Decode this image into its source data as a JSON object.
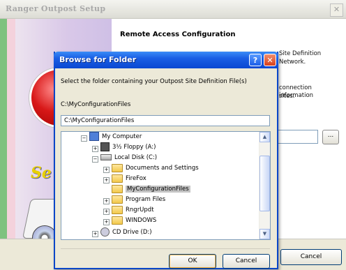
{
  "setup_window": {
    "title": "Ranger Outpost Setup",
    "close_glyph": "✕",
    "heading": "Remote Access Configuration",
    "side_text_1": "Site Definition",
    "side_text_2": "Network.",
    "side_text_3": "connection information",
    "side_text_4": "sites.",
    "banner_script": "Se",
    "browse_label": "...",
    "cancel_label": "Cancel"
  },
  "dialog": {
    "title": "Browse for Folder",
    "help_glyph": "?",
    "close_glyph": "✕",
    "instruction": "Select the folder containing your Outpost Site Definition File(s)",
    "current_path": "C:\\MyConfigurationFiles",
    "path_value": "C:\\MyConfigurationFiles",
    "ok_label": "OK",
    "cancel_label": "Cancel"
  },
  "tree": {
    "items": [
      {
        "label": "My Computer",
        "icon": "computer-icon",
        "expander": "−"
      },
      {
        "label": "3½ Floppy (A:)",
        "icon": "floppy-icon",
        "expander": "+"
      },
      {
        "label": "Local Disk (C:)",
        "icon": "drive-icon",
        "expander": "−"
      },
      {
        "label": "Documents and Settings",
        "icon": "folder-icon",
        "expander": "+"
      },
      {
        "label": "FireFox",
        "icon": "folder-icon",
        "expander": "+"
      },
      {
        "label": "MyConfigurationFiles",
        "icon": "folder-open-icon",
        "expander": "",
        "selected": true
      },
      {
        "label": "Program Files",
        "icon": "folder-icon",
        "expander": "+"
      },
      {
        "label": "RngrUpdt",
        "icon": "folder-icon",
        "expander": "+"
      },
      {
        "label": "WINDOWS",
        "icon": "folder-icon",
        "expander": "+"
      },
      {
        "label": "CD Drive (D:)",
        "icon": "cd-drive-icon",
        "expander": "+"
      }
    ]
  },
  "scrollbar": {
    "up_glyph": "▲",
    "down_glyph": "▼"
  }
}
